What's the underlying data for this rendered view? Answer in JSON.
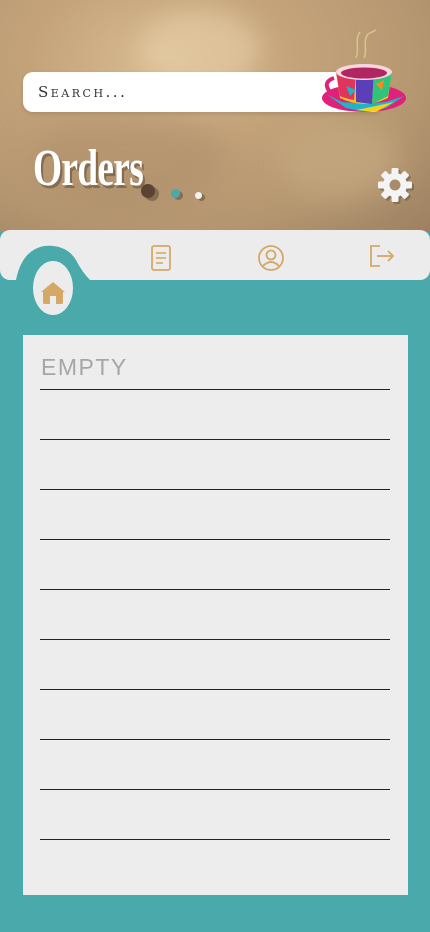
{
  "header": {
    "search_placeholder": "Search...",
    "title": "Orders",
    "logo_icon": "coffee-cup-logo-icon",
    "settings_icon": "gear-icon",
    "carousel_dots": 3
  },
  "tabs": [
    {
      "name": "home",
      "icon": "home-icon",
      "active": true
    },
    {
      "name": "orders",
      "icon": "document-icon",
      "active": false
    },
    {
      "name": "profile",
      "icon": "user-circle-icon",
      "active": false
    },
    {
      "name": "logout",
      "icon": "logout-icon",
      "active": false
    }
  ],
  "orders_list": {
    "empty_label": "EMPTY",
    "rows": 9
  },
  "colors": {
    "teal": "#4aa9aa",
    "tan": "#c4a37a",
    "icon_tan": "#d6a868",
    "panel": "#ececec"
  }
}
